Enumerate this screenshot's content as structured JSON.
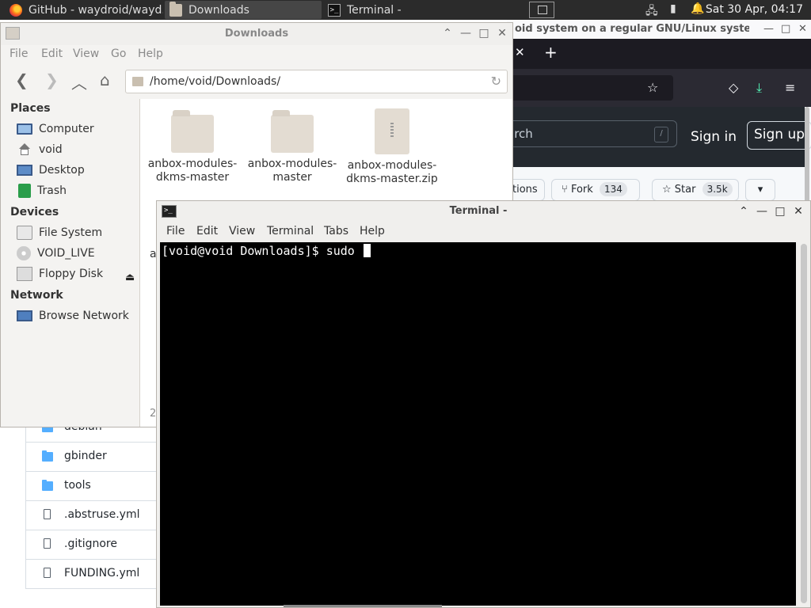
{
  "panel": {
    "tasks": [
      {
        "label": "GitHub - waydroid/wayd...",
        "icon": "firefox-icon"
      },
      {
        "label": "Downloads",
        "icon": "folder-icon"
      },
      {
        "label": "Terminal -",
        "icon": "terminal-icon"
      }
    ],
    "clock": "Sat 30 Apr, 04:17"
  },
  "browser": {
    "window_title": "oid system on a regular GNU/Linux syster",
    "search_placeholder": "arch",
    "search_key": "/",
    "sign_in": "Sign in",
    "sign_up": "Sign up",
    "actions_label": "tions",
    "fork_label": "Fork",
    "fork_count": "134",
    "star_label": "Star",
    "star_count": "3.5k",
    "files": [
      {
        "name": "debian",
        "type": "dir"
      },
      {
        "name": "gbinder",
        "type": "dir"
      },
      {
        "name": "tools",
        "type": "dir"
      },
      {
        "name": ".abstruse.yml",
        "type": "file"
      },
      {
        "name": ".gitignore",
        "type": "file"
      },
      {
        "name": "FUNDING.yml",
        "type": "file"
      }
    ]
  },
  "thunar": {
    "title": "Downloads",
    "menu": [
      "File",
      "Edit",
      "View",
      "Go",
      "Help"
    ],
    "path": "/home/void/Downloads/",
    "places_heading": "Places",
    "places": [
      "Computer",
      "void",
      "Desktop",
      "Trash"
    ],
    "devices_heading": "Devices",
    "devices": [
      "File System",
      "VOID_LIVE",
      "Floppy Disk"
    ],
    "network_heading": "Network",
    "network": [
      "Browse Network"
    ],
    "items": [
      {
        "name": "anbox-modules-dkms-master",
        "type": "folder"
      },
      {
        "name": "anbox-modules-master",
        "type": "folder"
      },
      {
        "name": "anbox-modules-dkms-master.zip",
        "type": "zip"
      }
    ],
    "status_peek": "2",
    "row2_peek": "a"
  },
  "terminal": {
    "title": "Terminal -",
    "menu": [
      "File",
      "Edit",
      "View",
      "Terminal",
      "Tabs",
      "Help"
    ],
    "prompt": "[void@void Downloads]$ sudo "
  },
  "colors": {
    "panel_bg": "#2b2b2b",
    "terminal_bg": "#000000",
    "github_header": "#24292f"
  }
}
